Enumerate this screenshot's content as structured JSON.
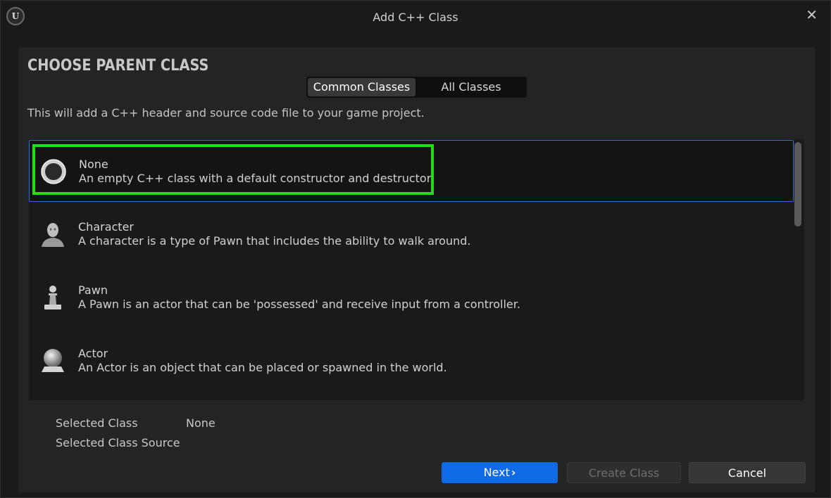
{
  "window": {
    "title": "Add C++ Class",
    "logo_text": "U",
    "close_glyph": "✕"
  },
  "panel": {
    "heading": "CHOOSE PARENT CLASS",
    "tabs": [
      {
        "label": "Common Classes",
        "active": true
      },
      {
        "label": "All Classes",
        "active": false
      }
    ],
    "description": "This will add a C++ header and source code file to your game project."
  },
  "classes": [
    {
      "name": "None",
      "description": "An empty C++ class with a default constructor and destructor.",
      "icon": "none-class-icon",
      "selected": true
    },
    {
      "name": "Character",
      "description": "A character is a type of Pawn that includes the ability to walk around.",
      "icon": "character-icon",
      "selected": false
    },
    {
      "name": "Pawn",
      "description": "A Pawn is an actor that can be 'possessed' and receive input from a controller.",
      "icon": "pawn-icon",
      "selected": false
    },
    {
      "name": "Actor",
      "description": "An Actor is an object that can be placed or spawned in the world.",
      "icon": "actor-icon",
      "selected": false
    }
  ],
  "info": {
    "selected_class_label": "Selected Class",
    "selected_class_value": "None",
    "selected_class_source_label": "Selected Class Source"
  },
  "buttons": {
    "next": "Next",
    "next_glyph": "›",
    "create_class": "Create Class",
    "cancel": "Cancel"
  },
  "colors": {
    "accent_blue": "#0f6ae6",
    "highlight_green": "#22dd11",
    "selection_border": "#2f6fe0"
  }
}
